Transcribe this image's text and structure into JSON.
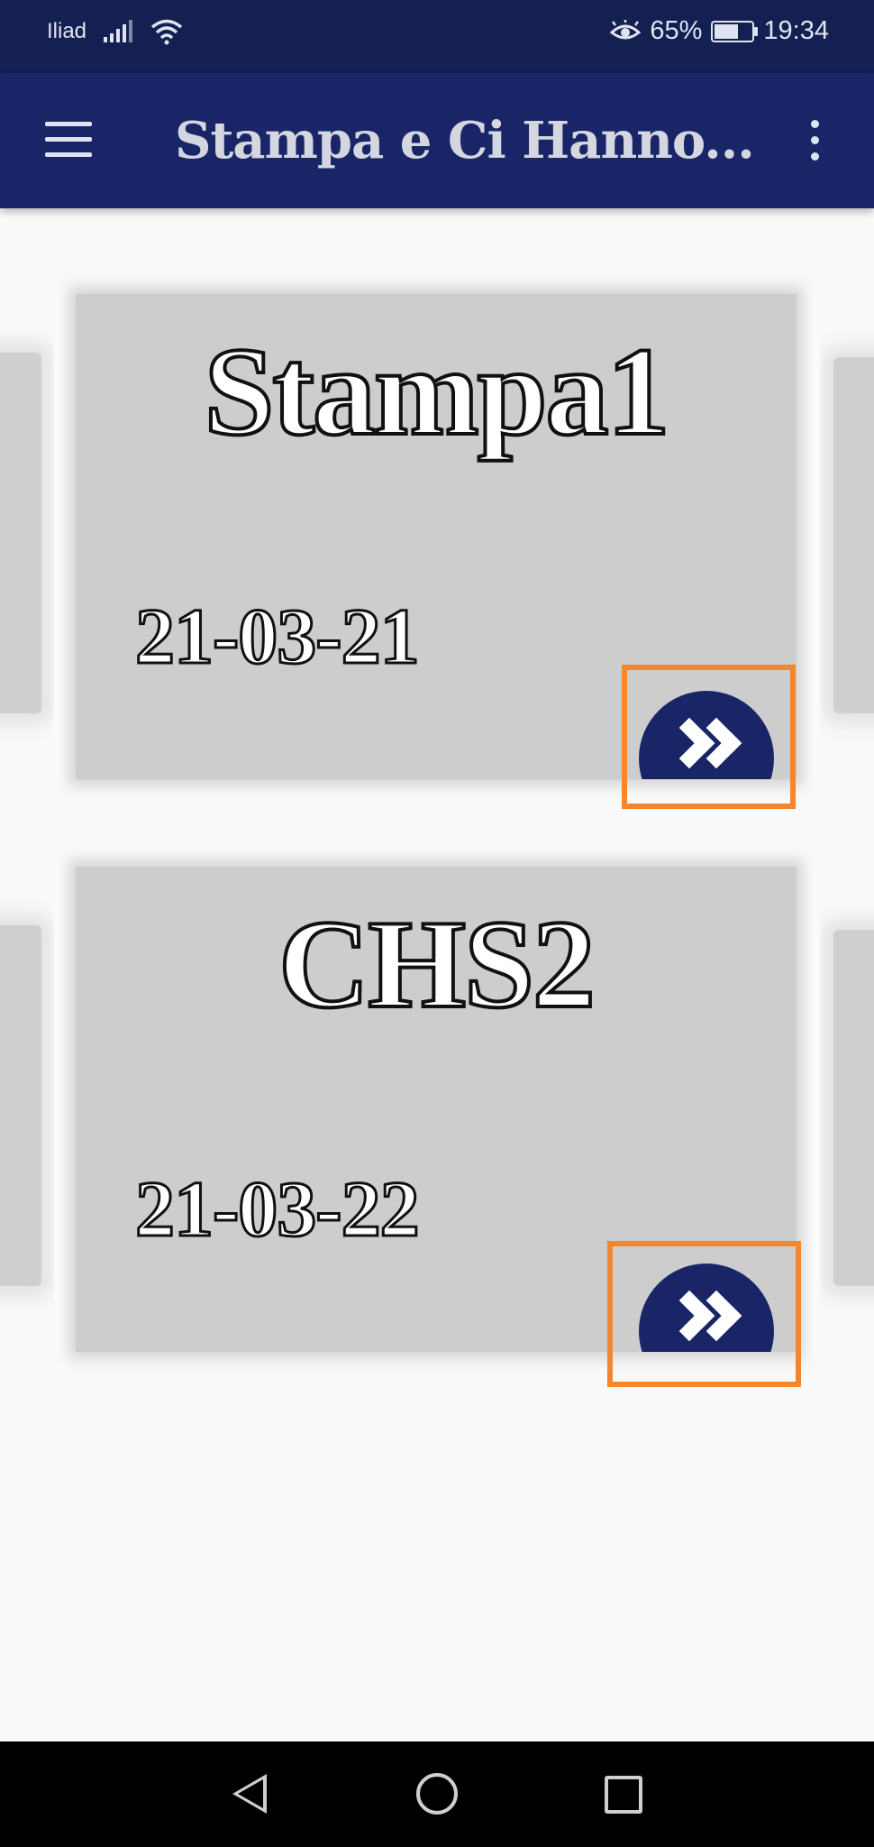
{
  "status_bar": {
    "carrier": "Iliad",
    "battery_percent": "65%",
    "battery_level": 0.65,
    "time": "19:34"
  },
  "app_bar": {
    "title": "Stampa e Ci Hanno..."
  },
  "cards": [
    {
      "title": "Stampa1",
      "date": "21-03-21",
      "icon": "double-chevron-right-icon"
    },
    {
      "title": "CHS2",
      "date": "21-03-22",
      "icon": "double-chevron-right-icon"
    }
  ],
  "colors": {
    "primary": "#1a2568",
    "status_bar": "#152052",
    "card_background": "#cdcdcd",
    "highlight": "#f5862c"
  }
}
